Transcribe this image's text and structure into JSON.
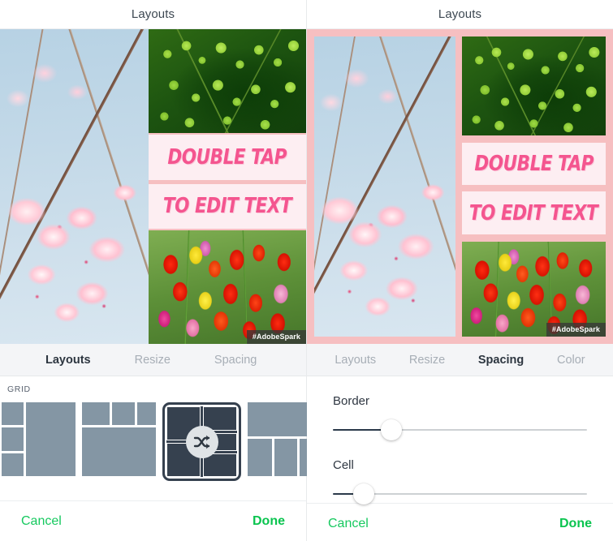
{
  "panels": [
    {
      "header": {
        "title": "Layouts"
      },
      "collage": {
        "bordered": false,
        "text_lines": [
          "DOUBLE TAP",
          "TO EDIT TEXT"
        ],
        "watermark": "#AdobeSpark",
        "cells": [
          {
            "name": "cherry-blossom-photo"
          },
          {
            "name": "green-leaves-photo"
          },
          {
            "name": "red-tulips-photo"
          }
        ]
      },
      "tabs": [
        {
          "label": "Layouts",
          "active": true
        },
        {
          "label": "Resize",
          "active": false
        },
        {
          "label": "Spacing",
          "active": false
        }
      ],
      "grid": {
        "section_label": "GRID",
        "shuffle_icon": "shuffle-icon",
        "thumbnails": [
          {
            "id": "layout-1",
            "selected": false
          },
          {
            "id": "layout-2",
            "selected": false
          },
          {
            "id": "layout-3",
            "selected": true
          },
          {
            "id": "layout-4",
            "selected": false
          }
        ]
      },
      "footer": {
        "cancel": "Cancel",
        "done": "Done"
      }
    },
    {
      "header": {
        "title": "Layouts"
      },
      "collage": {
        "bordered": true,
        "border_color": "#f6bfc1",
        "text_lines": [
          "DOUBLE TAP",
          "TO EDIT TEXT"
        ],
        "watermark": "#AdobeSpark",
        "cells": [
          {
            "name": "cherry-blossom-photo"
          },
          {
            "name": "green-leaves-photo"
          },
          {
            "name": "red-tulips-photo"
          }
        ]
      },
      "tabs": [
        {
          "label": "Layouts",
          "active": false
        },
        {
          "label": "Resize",
          "active": false
        },
        {
          "label": "Spacing",
          "active": true
        },
        {
          "label": "Color",
          "active": false
        }
      ],
      "sliders": [
        {
          "label": "Border",
          "value_percent": 23
        },
        {
          "label": "Cell",
          "value_percent": 12
        }
      ],
      "footer": {
        "cancel": "Cancel",
        "done": "Done"
      }
    }
  ],
  "colors": {
    "accent_green": "#0ac44f",
    "tab_active": "#2d3640",
    "tab_inactive": "#a7aeb6",
    "slider_active_track": "#2b3a4a",
    "slider_inactive_track": "#cdd1d4",
    "thumb_cell": "#8496a4",
    "thumb_selected": "#36414f",
    "collage_border_pink": "#f6bfc1",
    "text_band_pink": "#f4558f"
  }
}
